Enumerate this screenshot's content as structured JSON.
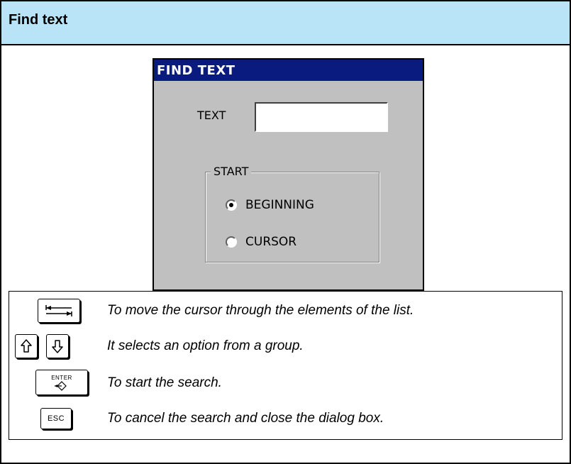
{
  "header": {
    "title": "Find text"
  },
  "dialog": {
    "title": "FIND TEXT",
    "text_label": "TEXT",
    "text_value": "",
    "group_label": "START",
    "options": [
      {
        "label": "BEGINNING",
        "selected": true
      },
      {
        "label": "CURSOR",
        "selected": false
      }
    ]
  },
  "keys": [
    {
      "key": "tab-key-icon",
      "description": "To move the cursor through the elements of the list."
    },
    {
      "key": "up-down-arrow-keys-icon",
      "description": "It selects an option from a group."
    },
    {
      "key_label": "ENTER",
      "description": "To start the search."
    },
    {
      "key_label": "ESC",
      "description": "To cancel the search and close the dialog box."
    }
  ]
}
